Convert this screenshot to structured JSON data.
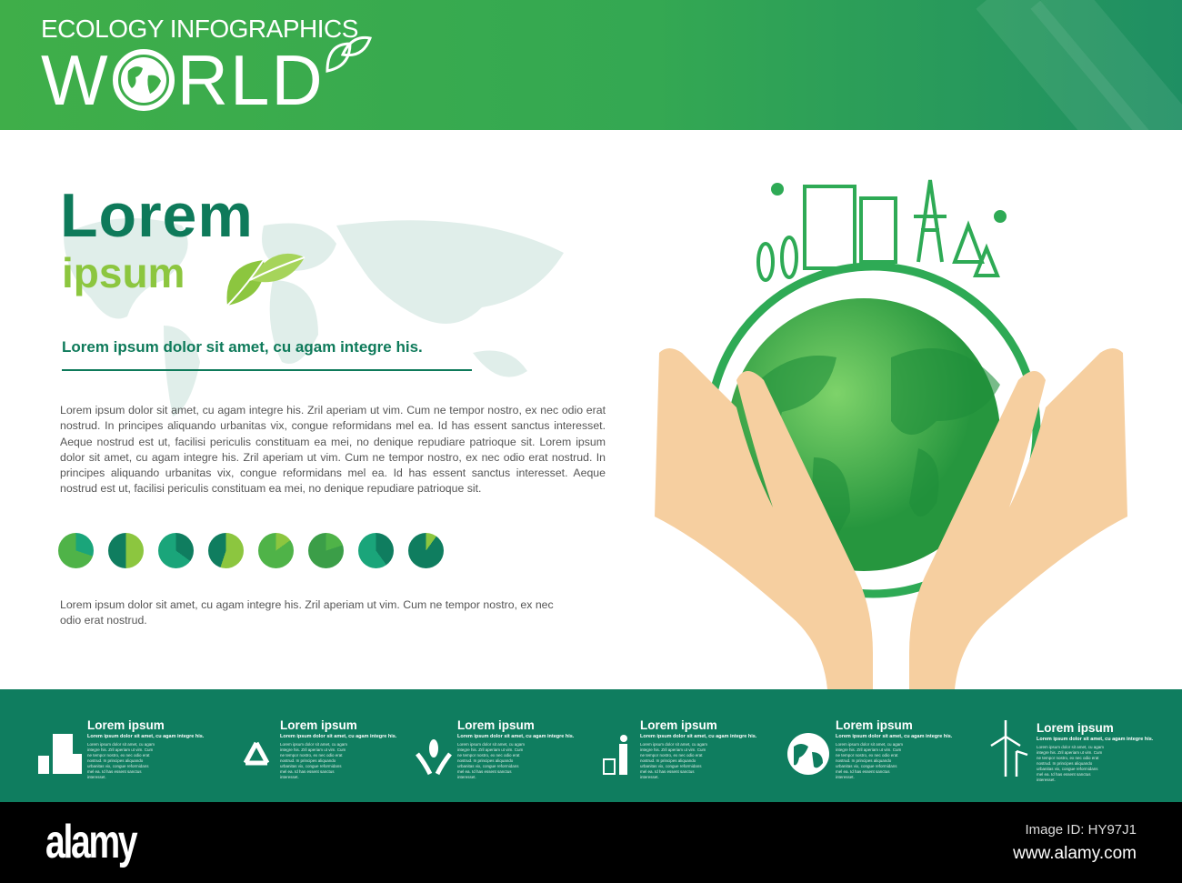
{
  "header": {
    "supertitle": "ECOLOGY INFOGRAPHICS",
    "title_left": "W",
    "title_right": "RLD"
  },
  "main": {
    "heading": "Lorem",
    "subheading": "ipsum",
    "tagline": "Lorem ipsum dolor sit amet, cu agam integre his.",
    "body1": "Lorem ipsum dolor sit amet, cu agam integre his. Zril aperiam ut vim. Cum ne tempor nostro, ex nec odio erat nostrud. In principes aliquando urbanitas vix, congue reformidans mel ea. Id has essent sanctus interesset. Aeque nostrud est ut, facilisi periculis constituam ea mei, no denique repudiare patrioque sit. Lorem ipsum dolor sit amet, cu agam integre his. Zril aperiam ut vim. Cum ne tempor nostro, ex nec odio erat nostrud. In principes aliquando urbanitas vix, congue reformidans mel ea. Id has essent sanctus interesset. Aeque nostrud est ut, facilisi periculis constituam ea mei, no denique repudiare patrioque sit.",
    "pies": [
      {
        "fraction": 0.3,
        "base": "#4fb348",
        "slice": "#1aa57a"
      },
      {
        "fraction": 0.5,
        "base": "#0f7d5f",
        "slice": "#8cc63f"
      },
      {
        "fraction": 0.35,
        "base": "#1aa57a",
        "slice": "#0f7d5f"
      },
      {
        "fraction": 0.55,
        "base": "#0f7d5f",
        "slice": "#8cc63f"
      },
      {
        "fraction": 0.15,
        "base": "#4fb348",
        "slice": "#8cc63f"
      },
      {
        "fraction": 0.2,
        "base": "#3b9e48",
        "slice": "#4fb348"
      },
      {
        "fraction": 0.4,
        "base": "#1aa57a",
        "slice": "#0f7d5f"
      },
      {
        "fraction": 0.1,
        "base": "#0f7d5f",
        "slice": "#8cc63f"
      }
    ],
    "body2": "Lorem ipsum dolor sit amet, cu agam integre his. Zril aperiam ut vim. Cum ne tempor nostro, ex nec odio erat nostrud."
  },
  "band": {
    "items": [
      {
        "icon": "buildings-icon",
        "title": "Lorem ipsum",
        "subtitle": "Lorem ipsum dolor sit amet, cu agam integre his.",
        "body": "Lorem ipsum dolor sit amet, cu agam integre his. Zril aperiam ut vim. Cum ne tempor nostro, ex nec odio erat nostrud. In principes aliquando urbanitas vix, congue reformidans mel ea. Id has essent sanctus interesset."
      },
      {
        "icon": "recycle-icon",
        "title": "Lorem ipsum",
        "subtitle": "Lorem ipsum dolor sit amet, cu agam integre his.",
        "body": "Lorem ipsum dolor sit amet, cu agam integre his. Zril aperiam ut vim. Cum ne tempor nostro, ex nec odio erat nostrud. In principes aliquando urbanitas vix, congue reformidans mel ea. Id has essent sanctus interesset."
      },
      {
        "icon": "hands-plant-icon",
        "title": "Lorem ipsum",
        "subtitle": "Lorem ipsum dolor sit amet, cu agam integre his.",
        "body": "Lorem ipsum dolor sit amet, cu agam integre his. Zril aperiam ut vim. Cum ne tempor nostro, ex nec odio erat nostrud. In principes aliquando urbanitas vix, congue reformidans mel ea. Id has essent sanctus interesset."
      },
      {
        "icon": "person-trash-icon",
        "title": "Lorem ipsum",
        "subtitle": "Lorem ipsum dolor sit amet, cu agam integre his.",
        "body": "Lorem ipsum dolor sit amet, cu agam integre his. Zril aperiam ut vim. Cum ne tempor nostro, ex nec odio erat nostrud. In principes aliquando urbanitas vix, congue reformidans mel ea. Id has essent sanctus interesset."
      },
      {
        "icon": "globe-icon",
        "title": "Lorem ipsum",
        "subtitle": "Lorem ipsum dolor sit amet, cu agam integre his.",
        "body": "Lorem ipsum dolor sit amet, cu agam integre his. Zril aperiam ut vim. Cum ne tempor nostro, ex nec odio erat nostrud. In principes aliquando urbanitas vix, congue reformidans mel ea. Id has essent sanctus interesset."
      },
      {
        "icon": "wind-turbine-icon",
        "title": "Lorem ipsum",
        "subtitle": "Lorem ipsum dolor sit amet, cu agam integre his.",
        "body": "Lorem ipsum dolor sit amet, cu agam integre his. Zril aperiam ut vim. Cum ne tempor nostro, ex nec odio erat nostrud. In principes aliquando urbanitas vix, congue reformidans mel ea. Id has essent sanctus interesset."
      }
    ]
  },
  "footer": {
    "logo": "alamy",
    "image_id": "Image ID: HY97J1",
    "url": "www.alamy.com"
  }
}
